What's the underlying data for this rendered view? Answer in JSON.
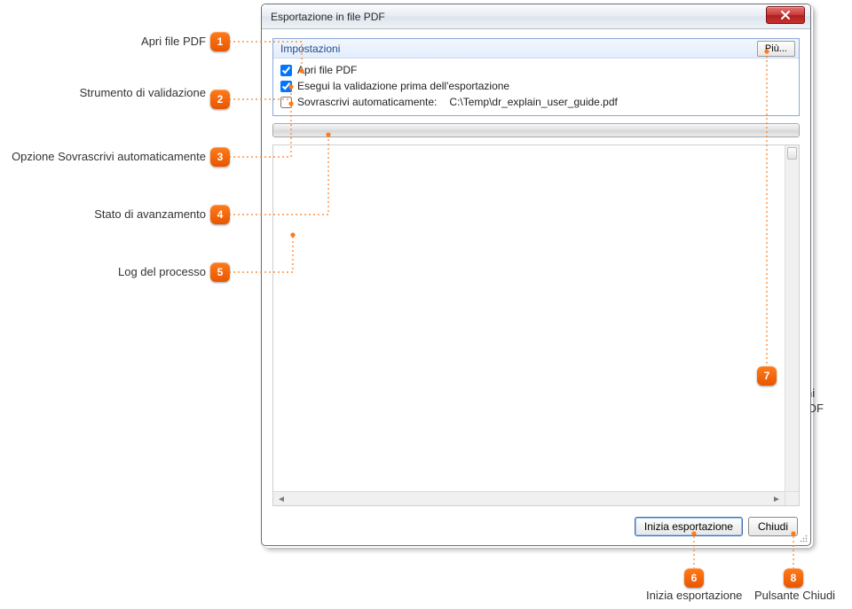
{
  "dialog": {
    "title": "Esportazione in file PDF"
  },
  "settings": {
    "header": "Impostazioni",
    "more_label": "Più...",
    "open_pdf_label": "Apri file PDF",
    "open_pdf_checked": true,
    "validate_label": "Esegui la validazione prima dell'esportazione",
    "validate_checked": true,
    "overwrite_label": "Sovrascrivi automaticamente:",
    "overwrite_checked": false,
    "overwrite_path": "C:\\Temp\\dr_explain_user_guide.pdf"
  },
  "buttons": {
    "start": "Inizia esportazione",
    "close": "Chiudi"
  },
  "callouts": {
    "c1": "Apri file PDF",
    "c2": "Strumento di validazione",
    "c3": "Opzione Sovrascrivi automaticamente",
    "c4": "Stato di avanzamento",
    "c5": "Log del processo",
    "c6": "Inizia esportazione",
    "c7": "Pulsante Opzioni esportazione in PDF",
    "c8": "Pulsante Chiudi"
  }
}
